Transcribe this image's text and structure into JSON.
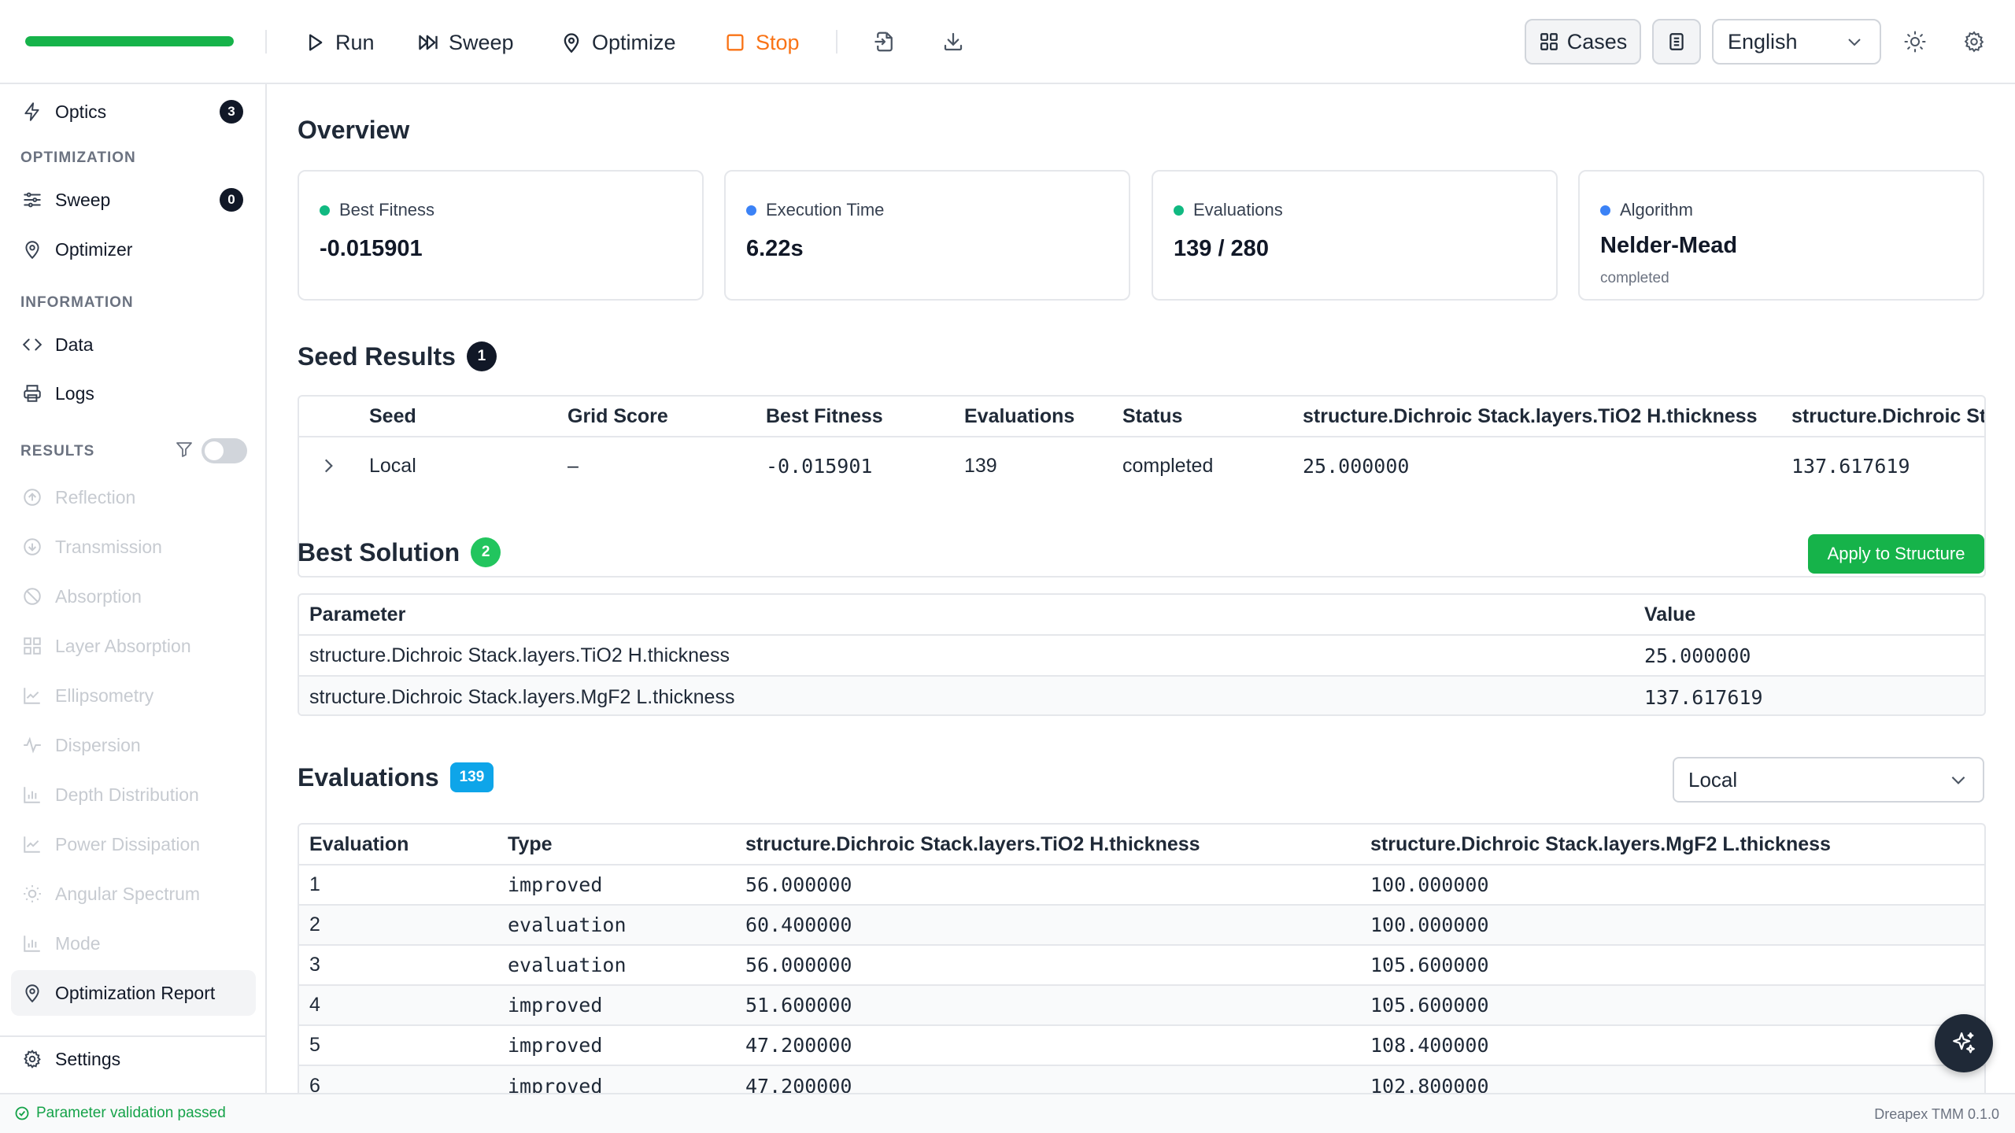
{
  "toolbar": {
    "progress_fraction": 1.0,
    "run_label": "Run",
    "sweep_label": "Sweep",
    "optimize_label": "Optimize",
    "stop_label": "Stop",
    "cases_label": "Cases",
    "language": "English"
  },
  "sidebar": {
    "optics": {
      "label": "Optics",
      "badge": "3"
    },
    "section_optimization": "OPTIMIZATION",
    "sweep": {
      "label": "Sweep",
      "badge": "0"
    },
    "optimizer": {
      "label": "Optimizer"
    },
    "section_information": "INFORMATION",
    "data": {
      "label": "Data"
    },
    "logs": {
      "label": "Logs"
    },
    "section_results": "RESULTS",
    "results": [
      "Reflection",
      "Transmission",
      "Absorption",
      "Layer Absorption",
      "Ellipsometry",
      "Dispersion",
      "Depth Distribution",
      "Power Dissipation",
      "Angular Spectrum",
      "Mode"
    ],
    "report": {
      "label": "Optimization Report"
    },
    "settings": {
      "label": "Settings"
    }
  },
  "overview": {
    "title": "Overview",
    "cards": [
      {
        "label": "Best Fitness",
        "value": "-0.015901",
        "color": "#10b981"
      },
      {
        "label": "Execution Time",
        "value": "6.22s",
        "color": "#3b82f6"
      },
      {
        "label": "Evaluations",
        "value": "139 / 280",
        "color": "#10b981"
      },
      {
        "label": "Algorithm",
        "value": "Nelder-Mead",
        "sub": "completed",
        "color": "#3b82f6"
      }
    ]
  },
  "seed_results": {
    "title": "Seed Results",
    "badge": "1",
    "headers": [
      "Seed",
      "Grid Score",
      "Best Fitness",
      "Evaluations",
      "Status",
      "structure.Dichroic Stack.layers.TiO2 H.thickness",
      "structure.Dichroic St"
    ],
    "rows": [
      [
        "Local",
        "–",
        "-0.015901",
        "139",
        "completed",
        "25.000000",
        "137.617619"
      ]
    ]
  },
  "best_solution": {
    "title": "Best Solution",
    "badge": "2",
    "apply_label": "Apply to Structure",
    "headers": [
      "Parameter",
      "Value"
    ],
    "rows": [
      [
        "structure.Dichroic Stack.layers.TiO2 H.thickness",
        "25.000000"
      ],
      [
        "structure.Dichroic Stack.layers.MgF2 L.thickness",
        "137.617619"
      ]
    ]
  },
  "evaluations": {
    "title": "Evaluations",
    "badge": "139",
    "filter": "Local",
    "headers": [
      "Evaluation",
      "Type",
      "structure.Dichroic Stack.layers.TiO2 H.thickness",
      "structure.Dichroic Stack.layers.MgF2 L.thickness"
    ],
    "rows": [
      [
        "1",
        "improved",
        "56.000000",
        "100.000000"
      ],
      [
        "2",
        "evaluation",
        "60.400000",
        "100.000000"
      ],
      [
        "3",
        "evaluation",
        "56.000000",
        "105.600000"
      ],
      [
        "4",
        "improved",
        "51.600000",
        "105.600000"
      ],
      [
        "5",
        "improved",
        "47.200000",
        "108.400000"
      ],
      [
        "6",
        "improved",
        "47.200000",
        "102.800000"
      ]
    ]
  },
  "status": {
    "message": "Parameter validation passed",
    "version": "Dreapex TMM 0.1.0"
  }
}
